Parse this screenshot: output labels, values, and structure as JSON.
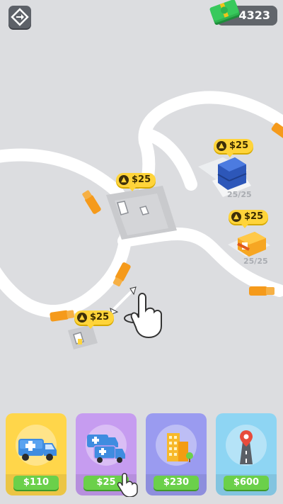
{
  "hud": {
    "money": "4323",
    "menu_icon": "diamond-swap-icon",
    "cash_icon": "cash-stack-icon"
  },
  "upgrade_tags": [
    {
      "label": "$25"
    },
    {
      "label": "$25"
    },
    {
      "label": "$25"
    },
    {
      "label": "$25"
    }
  ],
  "buildings": [
    {
      "name": "blue-building",
      "capacity": "25/25"
    },
    {
      "name": "shop-building",
      "capacity": "25/25"
    }
  ],
  "shop": {
    "cards": [
      {
        "item": "ambulance",
        "price": "$110",
        "bg": "#ffd64a",
        "base": "#f5c22e"
      },
      {
        "item": "ambulance-pair",
        "price": "$25",
        "bg": "#c69cf0",
        "base": "#b384e6"
      },
      {
        "item": "buildings",
        "price": "$230",
        "bg": "#9a9bf0",
        "base": "#8587e6"
      },
      {
        "item": "road",
        "price": "$600",
        "bg": "#8ed5f3",
        "base": "#74c4ea"
      }
    ]
  },
  "colors": {
    "background": "#dcdde0",
    "road": "#ffffff",
    "tag": "#ffd43a",
    "price_button": "#6bd04a"
  }
}
